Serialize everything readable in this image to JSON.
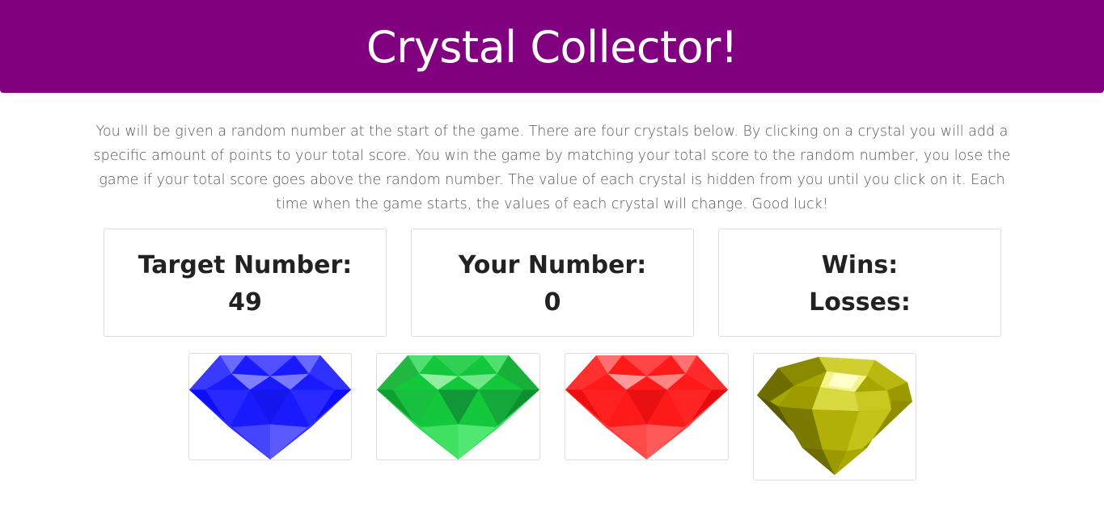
{
  "header": {
    "title": "Crystal Collector!",
    "background": "#800080"
  },
  "instructions": "You will be given a random number at the start of the game. There are four crystals below. By clicking on a crystal you will add a specific amount of points to your total score. You win the game by matching your total score to the random number, you lose the game if your total score goes above the random number. The value of each crystal is hidden from you until you click on it. Each time when the game starts, the values of each crystal will change. Good luck!",
  "target": {
    "label": "Target Number:",
    "value": "49"
  },
  "yours": {
    "label": "Your Number:",
    "value": "0"
  },
  "score": {
    "wins_label": "Wins:",
    "losses_label": "Losses:"
  },
  "crystals": [
    {
      "name": "blue-crystal",
      "color": "#1a1aff",
      "icon": "gem-icon"
    },
    {
      "name": "green-crystal",
      "color": "#14c83c",
      "icon": "gem-icon"
    },
    {
      "name": "red-crystal",
      "color": "#ff1a1a",
      "icon": "gem-icon"
    },
    {
      "name": "yellow-crystal",
      "color": "#b3b300",
      "icon": "gem-icon"
    }
  ]
}
